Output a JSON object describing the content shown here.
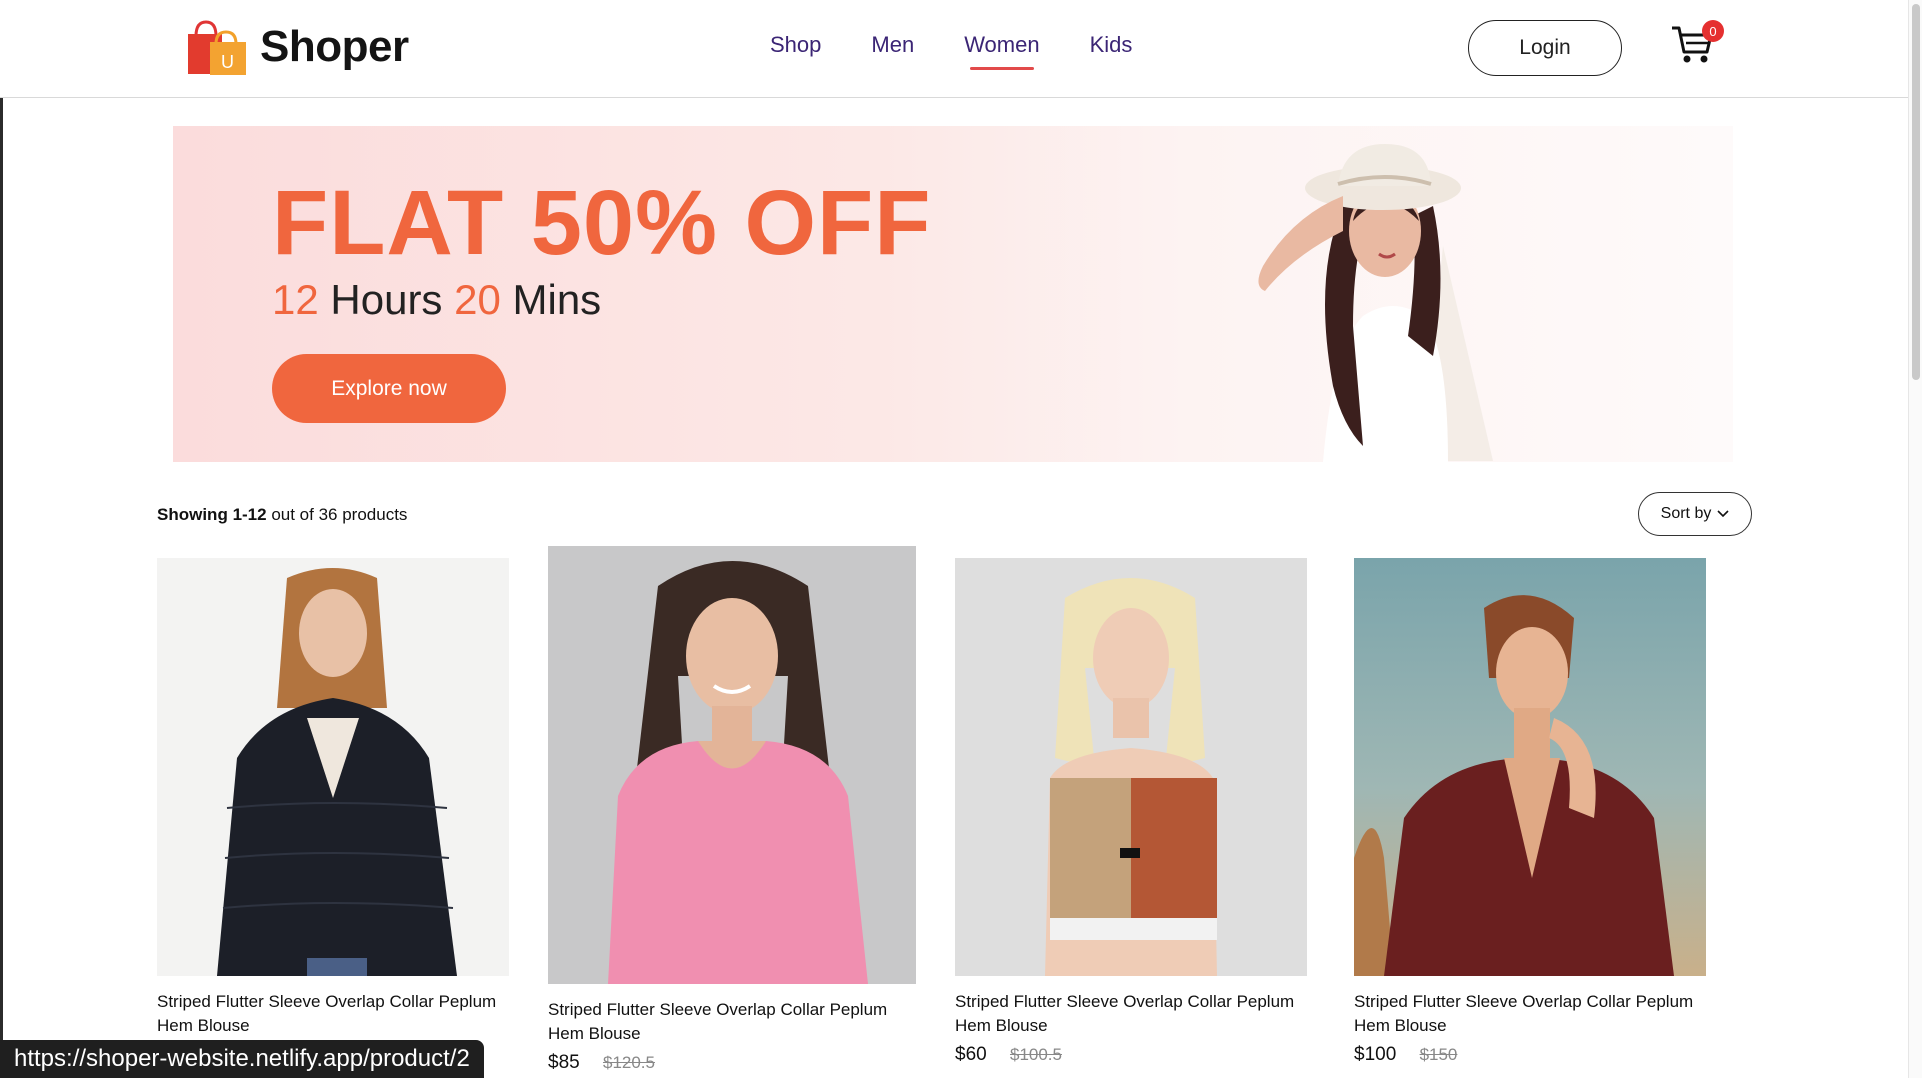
{
  "brand": {
    "name": "Shoper",
    "logo_letter": "U"
  },
  "nav": {
    "items": [
      {
        "label": "Shop"
      },
      {
        "label": "Men"
      },
      {
        "label": "Women",
        "active": true
      },
      {
        "label": "Kids"
      }
    ]
  },
  "header": {
    "login_label": "Login",
    "cart_count": "0"
  },
  "banner": {
    "headline": "FLAT 50% OFF",
    "hours_value": "12",
    "hours_label": "Hours",
    "mins_value": "20",
    "mins_label": "Mins",
    "cta_label": "Explore now"
  },
  "results": {
    "prefix": "Showing",
    "range": "1-12",
    "suffix": "out of 36 products"
  },
  "sort": {
    "label": "Sort by"
  },
  "products": [
    {
      "name": "Striped Flutter Sleeve Overlap Collar Peplum Hem Blouse",
      "price": "",
      "old_price": ""
    },
    {
      "name": "Striped Flutter Sleeve Overlap Collar Peplum Hem Blouse",
      "price": "$85",
      "old_price": "$120.5"
    },
    {
      "name": "Striped Flutter Sleeve Overlap Collar Peplum Hem Blouse",
      "price": "$60",
      "old_price": "$100.5"
    },
    {
      "name": "Striped Flutter Sleeve Overlap Collar Peplum Hem Blouse",
      "price": "$100",
      "old_price": "$150"
    }
  ],
  "status_bar": {
    "url": "https://shoper-website.netlify.app/product/2"
  },
  "colors": {
    "accent": "#f0663e",
    "nav_text": "#3b2575",
    "active_underline": "#e24a4a",
    "badge": "#e53030"
  }
}
